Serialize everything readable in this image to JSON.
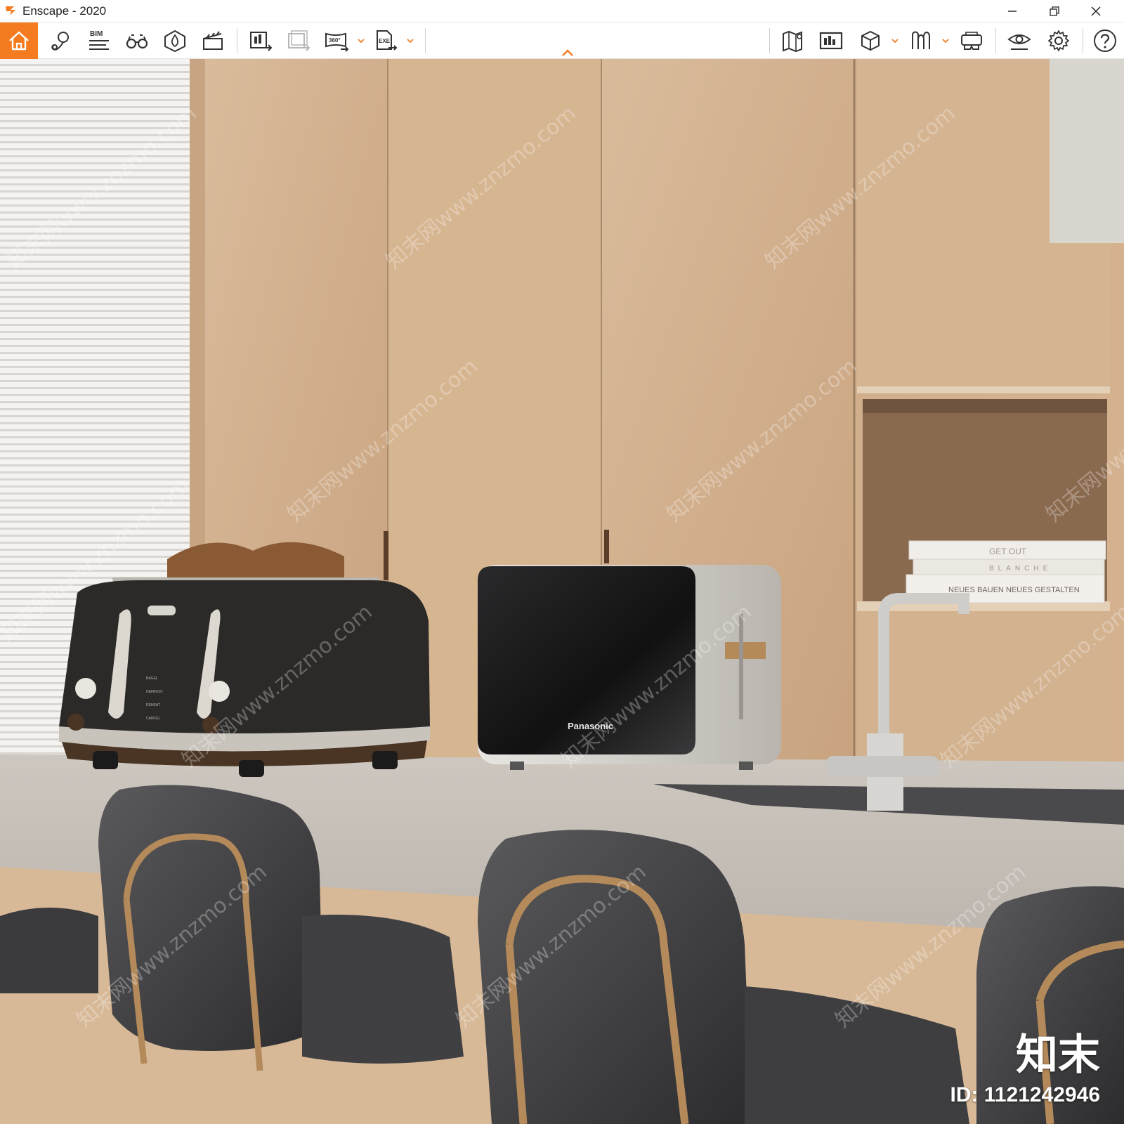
{
  "window": {
    "title": "Enscape - 2020",
    "accent_color": "#f47b20",
    "controls": [
      "minimize-icon",
      "restore-icon",
      "close-icon"
    ]
  },
  "toolbar": {
    "left_group": [
      {
        "name": "home",
        "icon": "home-icon",
        "active": true
      },
      {
        "name": "views",
        "icon": "map-pin-icon"
      },
      {
        "name": "bim",
        "icon": "bim-icon",
        "label": "BIM"
      },
      {
        "name": "walk-mode",
        "icon": "binoculars-icon"
      },
      {
        "name": "atmosphere",
        "icon": "atmosphere-icon"
      },
      {
        "name": "video-editor",
        "icon": "clapperboard-icon"
      }
    ],
    "export_group": [
      {
        "name": "export-image",
        "icon": "export-image-icon"
      },
      {
        "name": "batch-render",
        "icon": "batch-render-icon",
        "disabled": true
      },
      {
        "name": "export-panorama",
        "icon": "panorama-360-icon",
        "label": "360°",
        "has_dropdown": true
      },
      {
        "name": "export-exe",
        "icon": "export-exe-icon",
        "label": "EXE",
        "has_dropdown": true
      }
    ],
    "right_group": [
      {
        "name": "map",
        "icon": "map-icon"
      },
      {
        "name": "upload",
        "icon": "upload-icon"
      },
      {
        "name": "asset-library",
        "icon": "cube-icon",
        "has_dropdown": true
      },
      {
        "name": "material-editor",
        "icon": "material-icon",
        "has_dropdown": true
      },
      {
        "name": "vr-headset",
        "icon": "vr-headset-icon"
      },
      {
        "name": "visual-settings",
        "icon": "eye-icon"
      },
      {
        "name": "general-settings",
        "icon": "gear-icon"
      },
      {
        "name": "help",
        "icon": "help-icon"
      }
    ]
  },
  "scene": {
    "watermark_text": "知末网www.znzmo.com",
    "product_brand": "Panasonic",
    "toaster_labels": [
      "BAGEL",
      "DEFROST",
      "REHEAT",
      "CANCEL"
    ],
    "books": [
      "GET OUT",
      "BLANCHE",
      "NEUES BAUEN NEUES GESTALTEN"
    ],
    "badge_logo": "知末",
    "badge_id": "ID: 1121242946"
  }
}
